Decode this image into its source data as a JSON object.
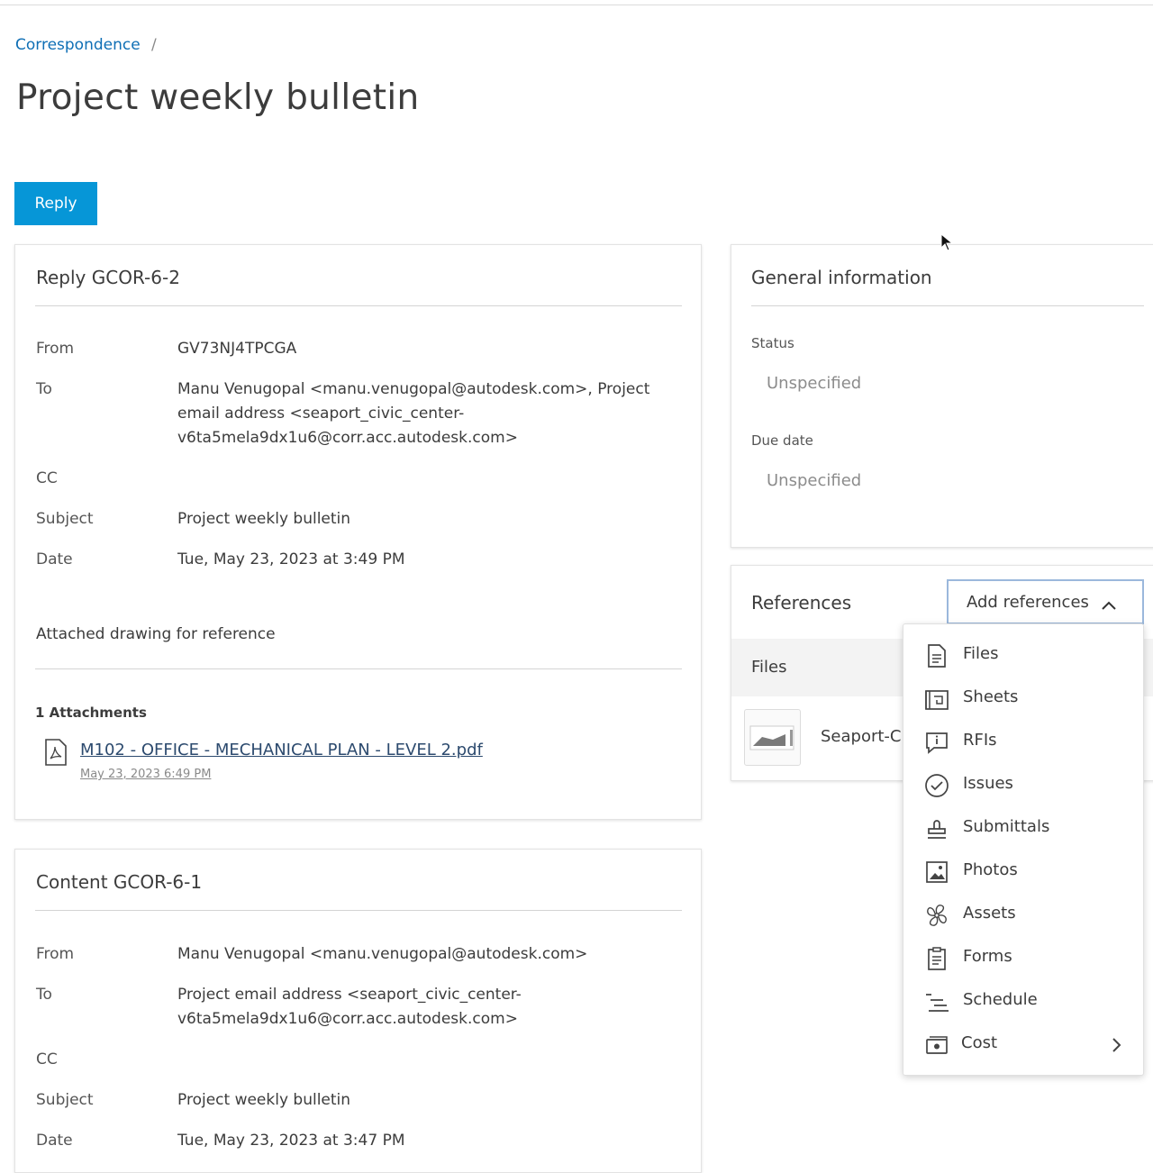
{
  "breadcrumb": {
    "link": "Correspondence",
    "separator": "/"
  },
  "page_title": "Project weekly bulletin",
  "reply_button": "Reply",
  "reply_card": {
    "title": "Reply GCOR-6-2",
    "from_label": "From",
    "from_value": "GV73NJ4TPCGA",
    "to_label": "To",
    "to_lines": [
      "Manu Venugopal <manu.venugopal@autodesk.com>, Project",
      "email address <seaport_civic_center-",
      "v6ta5mela9dx1u6@corr.acc.autodesk.com>"
    ],
    "cc_label": "CC",
    "subject_label": "Subject",
    "subject_value": "Project weekly bulletin",
    "date_label": "Date",
    "date_value": "Tue, May 23, 2023 at 3:49 PM",
    "body": "Attached drawing for reference",
    "attachments_heading": "1 Attachments",
    "attachment_name": "M102 - OFFICE - MECHANICAL PLAN - LEVEL 2.pdf",
    "attachment_date": "May 23, 2023 6:49 PM",
    "attachment_icon": "pdf-file-icon"
  },
  "content_card": {
    "title": "Content GCOR-6-1",
    "from_label": "From",
    "from_value": "Manu Venugopal <manu.venugopal@autodesk.com>",
    "to_label": "To",
    "to_lines": [
      "Project email address <seaport_civic_center-",
      "v6ta5mela9dx1u6@corr.acc.autodesk.com>"
    ],
    "cc_label": "CC",
    "subject_label": "Subject",
    "subject_value": "Project weekly bulletin",
    "date_label": "Date",
    "date_value": "Tue, May 23, 2023 at 3:47 PM"
  },
  "general_info": {
    "title": "General information",
    "status_label": "Status",
    "status_value": "Unspecified",
    "due_label": "Due date",
    "due_value": "Unspecified"
  },
  "references": {
    "title": "References",
    "add_button": "Add references",
    "files_heading": "Files",
    "file_name": "Seaport-Ci"
  },
  "add_references_menu": [
    {
      "label": "Files",
      "icon": "file-icon"
    },
    {
      "label": "Sheets",
      "icon": "sheets-icon"
    },
    {
      "label": "RFIs",
      "icon": "rfi-icon"
    },
    {
      "label": "Issues",
      "icon": "issues-icon"
    },
    {
      "label": "Submittals",
      "icon": "stamp-icon"
    },
    {
      "label": "Photos",
      "icon": "photo-icon"
    },
    {
      "label": "Assets",
      "icon": "fan-icon"
    },
    {
      "label": "Forms",
      "icon": "clipboard-icon"
    },
    {
      "label": "Schedule",
      "icon": "schedule-icon"
    },
    {
      "label": "Cost",
      "icon": "cost-icon",
      "has_submenu": true
    }
  ],
  "colors": {
    "accent": "#0696d7",
    "link": "#0f6fb5",
    "text": "#3c3c3c",
    "muted": "#8c8c8c"
  }
}
